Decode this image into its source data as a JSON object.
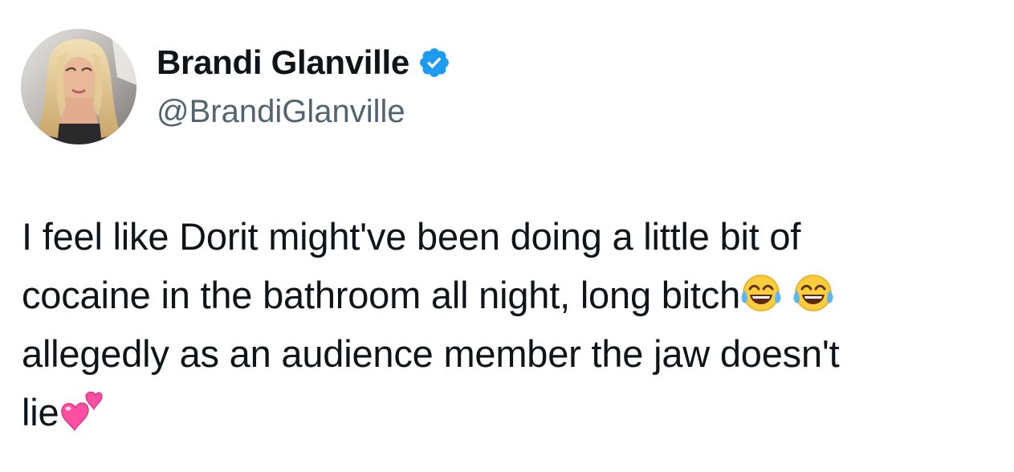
{
  "author": {
    "display_name": "Brandi Glanville",
    "handle": "@BrandiGlanville",
    "verified": true,
    "verified_color": "#1d9bf0"
  },
  "tweet": {
    "lines": [
      "I feel like Dorit might've been doing a little bit of",
      "cocaine in the bathroom all night, long bitch",
      "allegedly as an audience member  the jaw doesn't",
      "lie"
    ],
    "emojis": [
      "face-with-tears-of-joy",
      "face-with-tears-of-joy",
      "two-hearts"
    ]
  },
  "colors": {
    "text": "#0f1419",
    "secondary_text": "#536471",
    "background": "#ffffff"
  }
}
